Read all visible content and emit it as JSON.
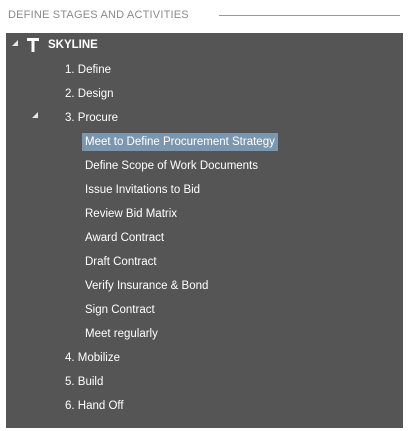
{
  "header": {
    "title": "DEFINE STAGES AND ACTIVITIES"
  },
  "tree": {
    "root": {
      "label": "SKYLINE",
      "icon": "hammer-icon",
      "expanded": true
    },
    "stages": [
      {
        "label": "1. Define"
      },
      {
        "label": "2. Design"
      },
      {
        "label": "3. Procure",
        "expanded": true,
        "activities": [
          {
            "label": "Meet to Define Procurement Strategy",
            "selected": true
          },
          {
            "label": "Define Scope of Work Documents"
          },
          {
            "label": "Issue Invitations to Bid"
          },
          {
            "label": "Review Bid Matrix"
          },
          {
            "label": "Award Contract"
          },
          {
            "label": "Draft Contract"
          },
          {
            "label": "Verify Insurance & Bond"
          },
          {
            "label": "Sign Contract"
          },
          {
            "label": "Meet regularly"
          }
        ]
      },
      {
        "label": "4. Mobilize"
      },
      {
        "label": "5. Build"
      },
      {
        "label": "6. Hand Off"
      }
    ]
  },
  "colors": {
    "panel_bg": "#555555",
    "selection_bg": "#7b97b0",
    "text": "#ffffff",
    "header_text": "#8a8a8a"
  }
}
